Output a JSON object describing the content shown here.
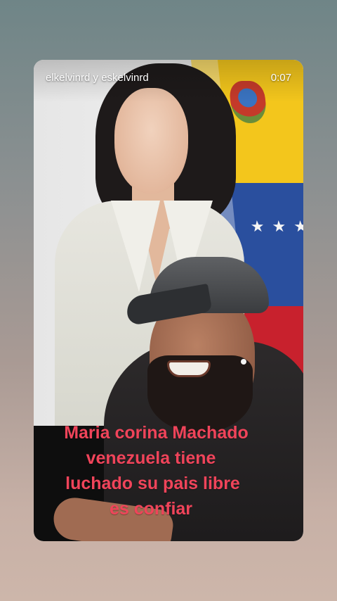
{
  "story": {
    "username": "elkelvinrd y eskelvinrd",
    "timer": "0:07"
  },
  "caption": {
    "lines": [
      "Maria corina Machado",
      "venezuela tiene",
      "luchado su pais libre",
      "es confiar"
    ],
    "color": "#f0445a"
  },
  "colors": {
    "background_top": "#6f8587",
    "background_bottom": "#cdb6aa",
    "caption_bg": "#0e0e0e"
  }
}
